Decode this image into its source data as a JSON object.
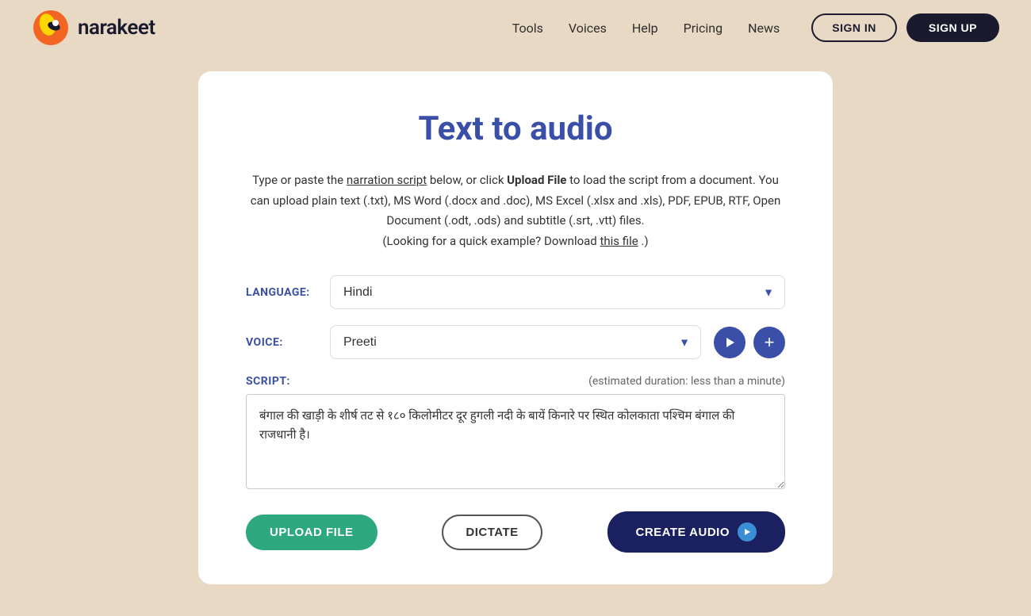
{
  "header": {
    "logo_text": "narakeet",
    "nav": {
      "tools": "Tools",
      "voices": "Voices",
      "help": "Help",
      "pricing": "Pricing",
      "news": "News"
    },
    "sign_in": "SIGN IN",
    "sign_up": "SIGN UP"
  },
  "main": {
    "title": "Text to audio",
    "description_part1": "Type or paste the",
    "narration_script_link": "narration script",
    "description_part2": " below, or click ",
    "upload_file_bold": "Upload File",
    "description_part3": " to load the script from a document. You can upload plain text (.txt), MS Word (.docx and .doc), MS Excel (.xlsx and .xls), PDF, EPUB, RTF, Open Document (.odt, .ods) and subtitle (.srt, .vtt) files.",
    "description_part4": "(Looking for a quick example? Download ",
    "this_file_link": "this file",
    "description_part5": ".)",
    "language_label": "LANGUAGE:",
    "language_value": "Hindi",
    "voice_label": "VOICE:",
    "voice_value": "Preeti",
    "script_label": "SCRIPT:",
    "estimated_duration": "(estimated duration: less than a minute)",
    "script_text": "बंगाल की खाड़ी के शीर्ष तट से १८० किलोमीटर दूर हुगली नदी के बायें किनारे पर स्थित कोलकाता पश्चिम बंगाल की राजधानी है।",
    "upload_file_btn": "UPLOAD FILE",
    "dictate_btn": "DICTATE",
    "create_audio_btn": "CREATE AUDIO"
  }
}
